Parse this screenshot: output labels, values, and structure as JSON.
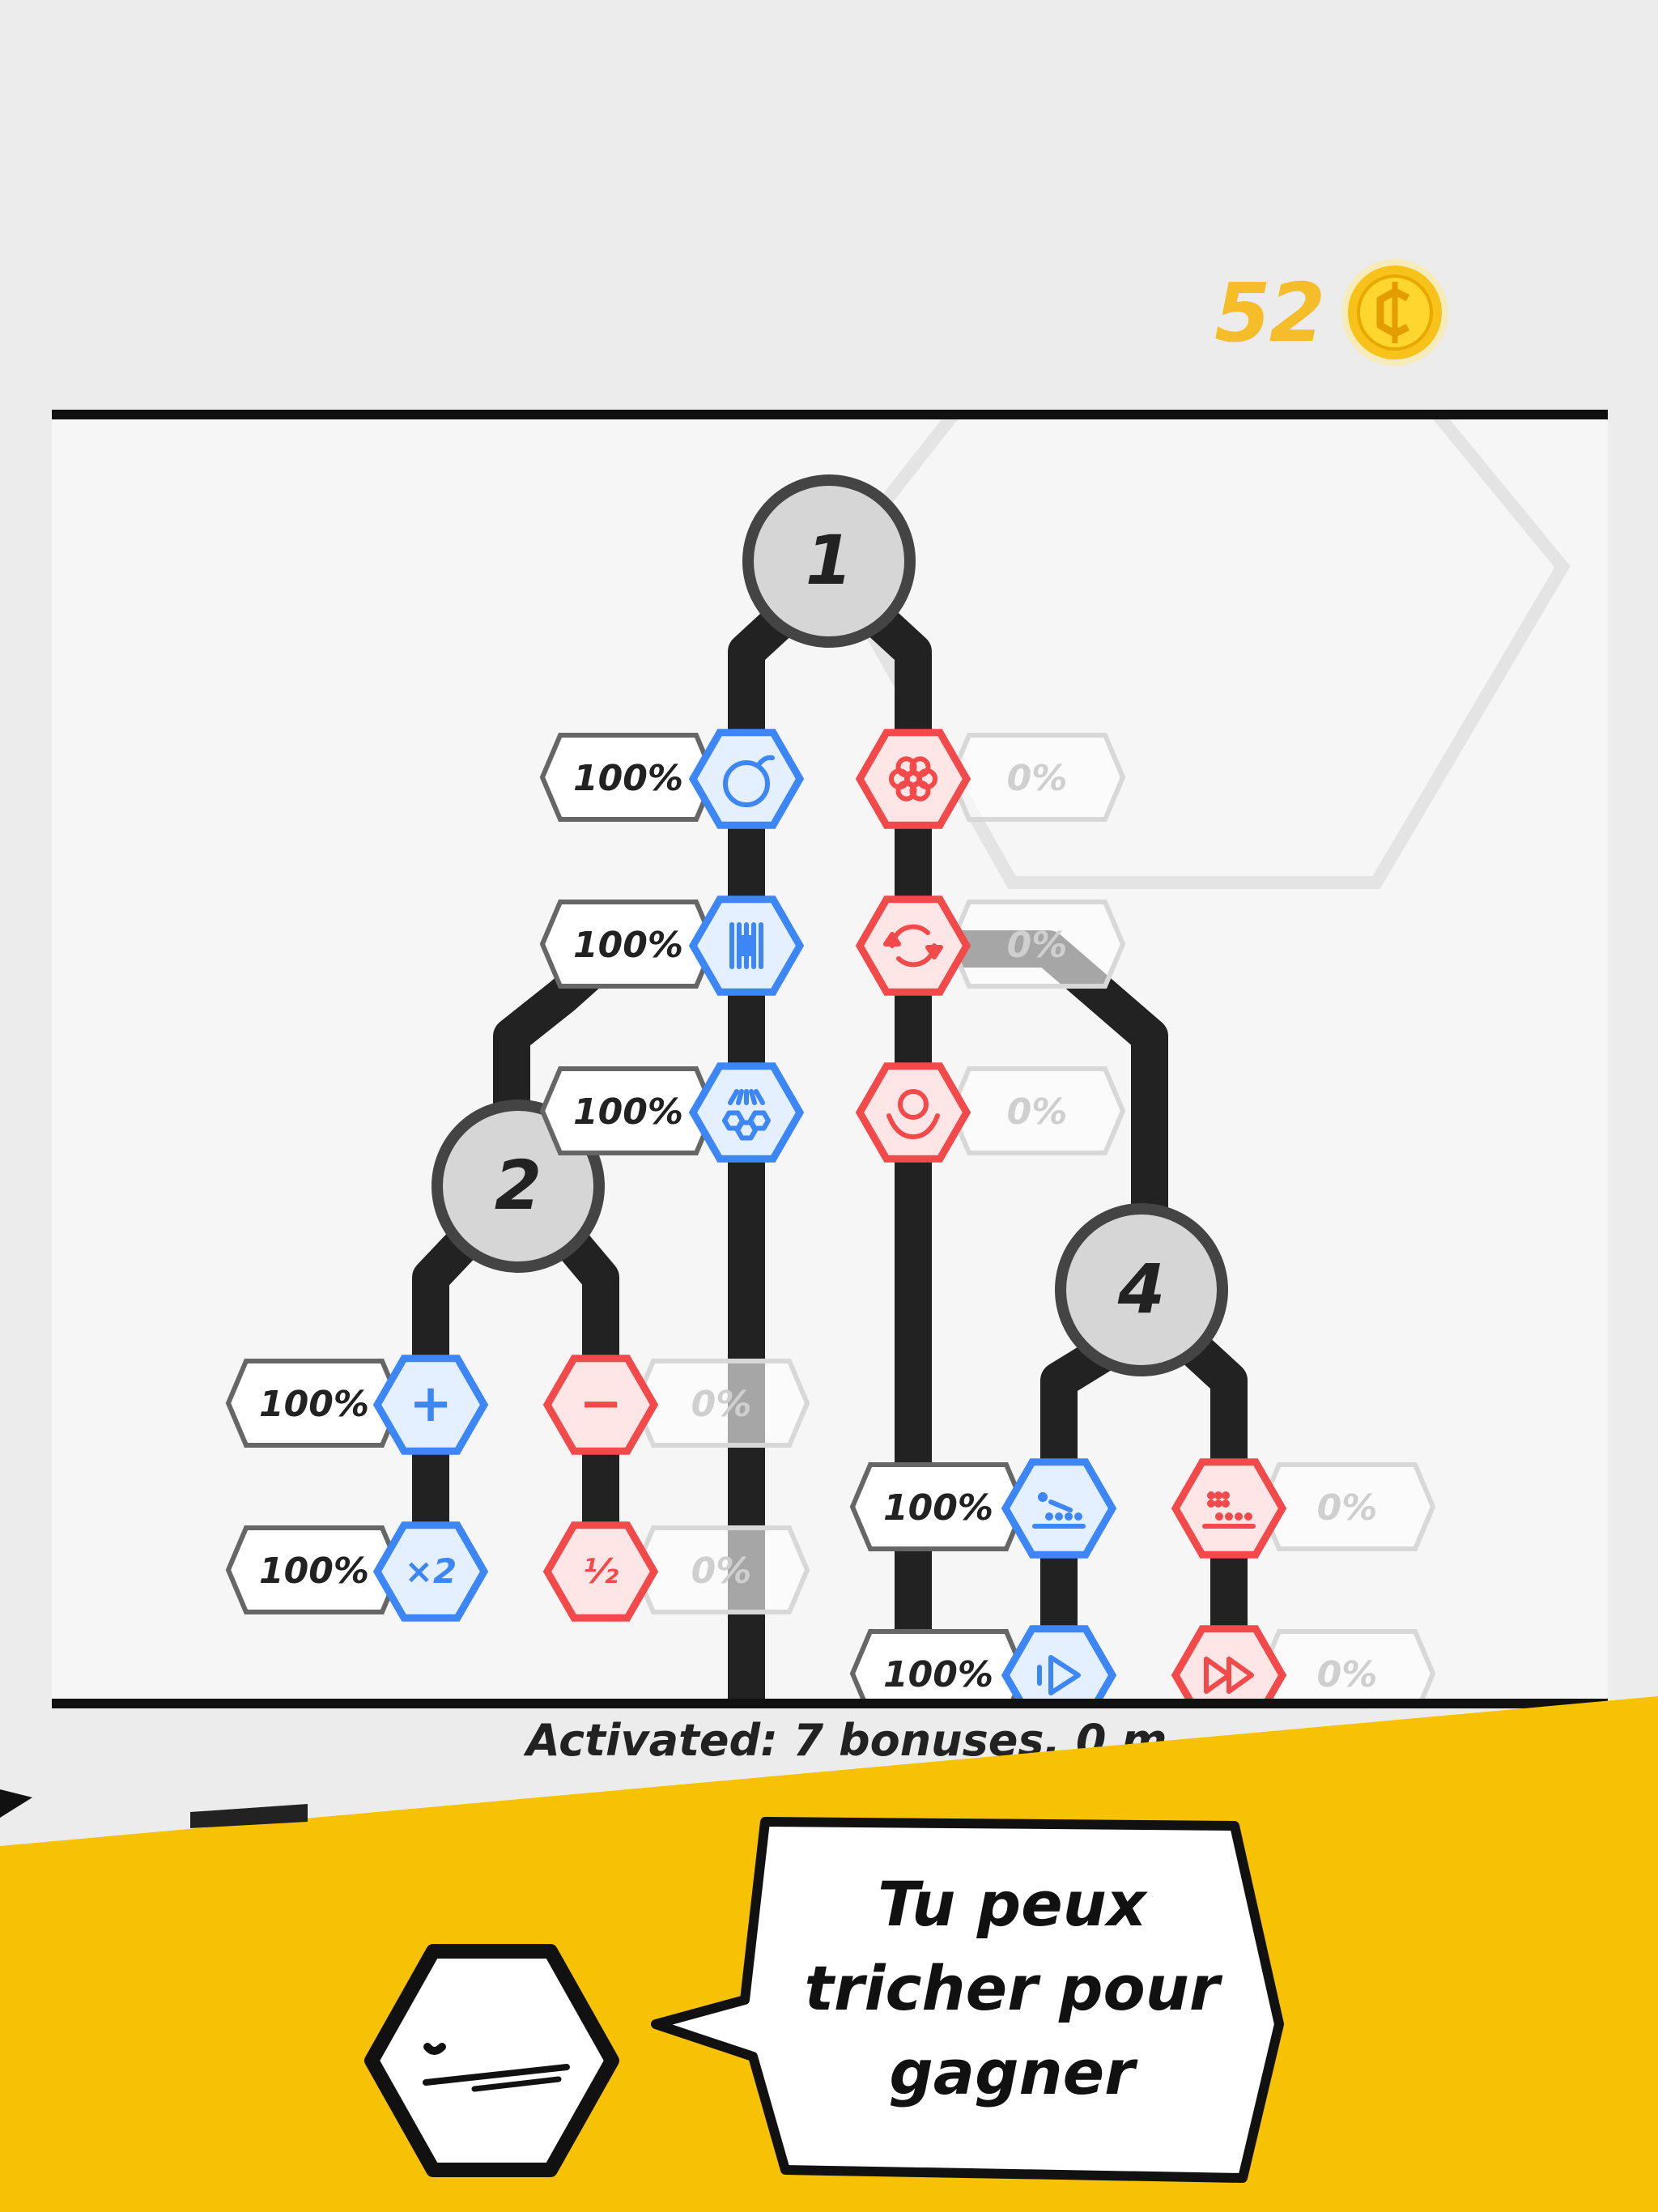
{
  "header": {
    "coins": "52",
    "coin_icon": "coin-icon"
  },
  "tree": {
    "nodes": [
      {
        "id": "node-1",
        "label": "1"
      },
      {
        "id": "node-2",
        "label": "2"
      },
      {
        "id": "node-4",
        "label": "4"
      }
    ],
    "bonuses": [
      {
        "name": "bomb",
        "color": "blue",
        "percent": "100%",
        "icon": "bomb-icon"
      },
      {
        "name": "columns",
        "color": "blue",
        "percent": "100%",
        "icon": "columns-icon"
      },
      {
        "name": "burst",
        "color": "blue",
        "percent": "100%",
        "icon": "burst-icon"
      },
      {
        "name": "flower",
        "color": "red",
        "percent": "0%",
        "icon": "flower-icon"
      },
      {
        "name": "swap",
        "color": "red",
        "percent": "0%",
        "icon": "swap-icon"
      },
      {
        "name": "bubble",
        "color": "red",
        "percent": "0%",
        "icon": "bubble-icon"
      },
      {
        "name": "plus",
        "color": "blue",
        "percent": "100%",
        "icon": "plus-icon",
        "glyph": "+"
      },
      {
        "name": "times-two",
        "color": "blue",
        "percent": "100%",
        "icon": "times-two-icon",
        "glyph": "×2"
      },
      {
        "name": "minus",
        "color": "red",
        "percent": "0%",
        "icon": "minus-icon",
        "glyph": "−"
      },
      {
        "name": "half",
        "color": "red",
        "percent": "0%",
        "icon": "half-icon",
        "glyph": "½"
      },
      {
        "name": "slow-balls",
        "color": "blue",
        "percent": "100%",
        "icon": "slow-balls-icon"
      },
      {
        "name": "play",
        "color": "blue",
        "percent": "100%",
        "icon": "play-icon"
      },
      {
        "name": "many-balls",
        "color": "red",
        "percent": "0%",
        "icon": "many-balls-icon"
      },
      {
        "name": "fast-forward",
        "color": "red",
        "percent": "0%",
        "icon": "fast-forward-icon"
      }
    ]
  },
  "status": {
    "text": "Activated: 7 bonuses, 0 m"
  },
  "dialog": {
    "speech": "Tu peux tricher pour gagner",
    "character_icon": "hexagon-face-icon"
  },
  "colors": {
    "blue": "#3d86f5",
    "blue_fill": "#e4efff",
    "red": "#f24a4a",
    "red_fill": "#ffe6e6",
    "coin": "#f6bd2a",
    "footer": "#f6c203",
    "line": "#222222"
  }
}
